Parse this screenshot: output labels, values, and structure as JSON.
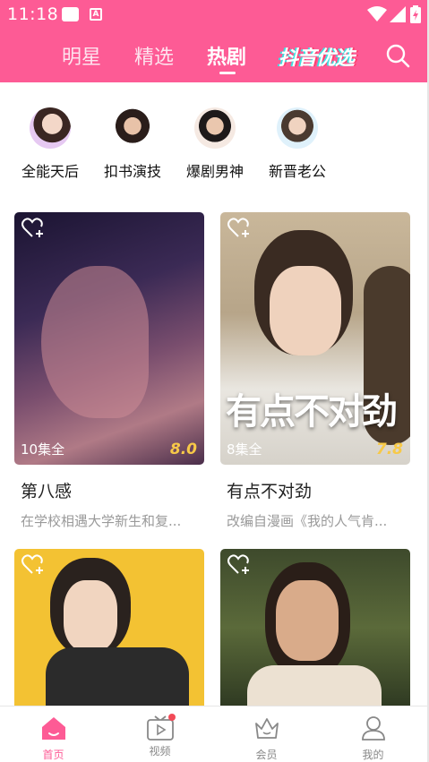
{
  "status_bar": {
    "time": "11:18"
  },
  "header": {
    "tabs": [
      {
        "label": "明星",
        "active": false
      },
      {
        "label": "精选",
        "active": false
      },
      {
        "label": "热剧",
        "active": true
      }
    ],
    "brand": "抖音优选",
    "search_icon": "search-icon"
  },
  "stars": [
    {
      "label": "全能天后"
    },
    {
      "label": "扣书演技"
    },
    {
      "label": "爆剧男神"
    },
    {
      "label": "新晋老公"
    }
  ],
  "cards": [
    {
      "episodes": "10集全",
      "score": "8.0",
      "title": "第八感",
      "desc": "在学校相遇大学新生和复..."
    },
    {
      "episodes": "8集全",
      "score": "7.8",
      "title": "有点不对劲",
      "desc": "改编自漫画《我的人气肯...",
      "overlay": "有点不对劲"
    },
    {
      "episodes": "",
      "score": "",
      "title": "",
      "desc": ""
    },
    {
      "episodes": "",
      "score": "",
      "title": "",
      "desc": ""
    }
  ],
  "bottom_nav": [
    {
      "label": "首页",
      "icon": "home-icon",
      "active": true
    },
    {
      "label": "视频",
      "icon": "video-icon",
      "active": false
    },
    {
      "label": "会员",
      "icon": "crown-icon",
      "active": false
    },
    {
      "label": "我的",
      "icon": "profile-icon",
      "active": false
    }
  ],
  "colors": {
    "brand": "#fd5b95",
    "score": "#f7c948",
    "badge": "#f24a57"
  }
}
